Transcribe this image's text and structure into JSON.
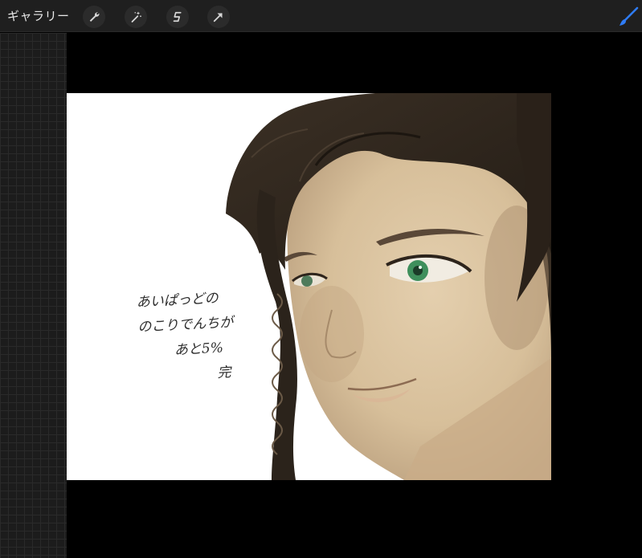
{
  "toolbar": {
    "gallery_label": "ギャラリー",
    "tools": [
      {
        "name": "actions",
        "icon": "wrench-icon"
      },
      {
        "name": "adjustments",
        "icon": "magic-wand-icon"
      },
      {
        "name": "selection",
        "icon": "selection-s-icon"
      },
      {
        "name": "transform",
        "icon": "arrow-cursor-icon"
      }
    ],
    "brush_icon": "brush-icon",
    "accent_color": "#2f7cf6"
  },
  "artwork": {
    "handwritten_lines": [
      "あいぱっどの",
      "のこりでんちが",
      "あと5%",
      "完"
    ]
  }
}
